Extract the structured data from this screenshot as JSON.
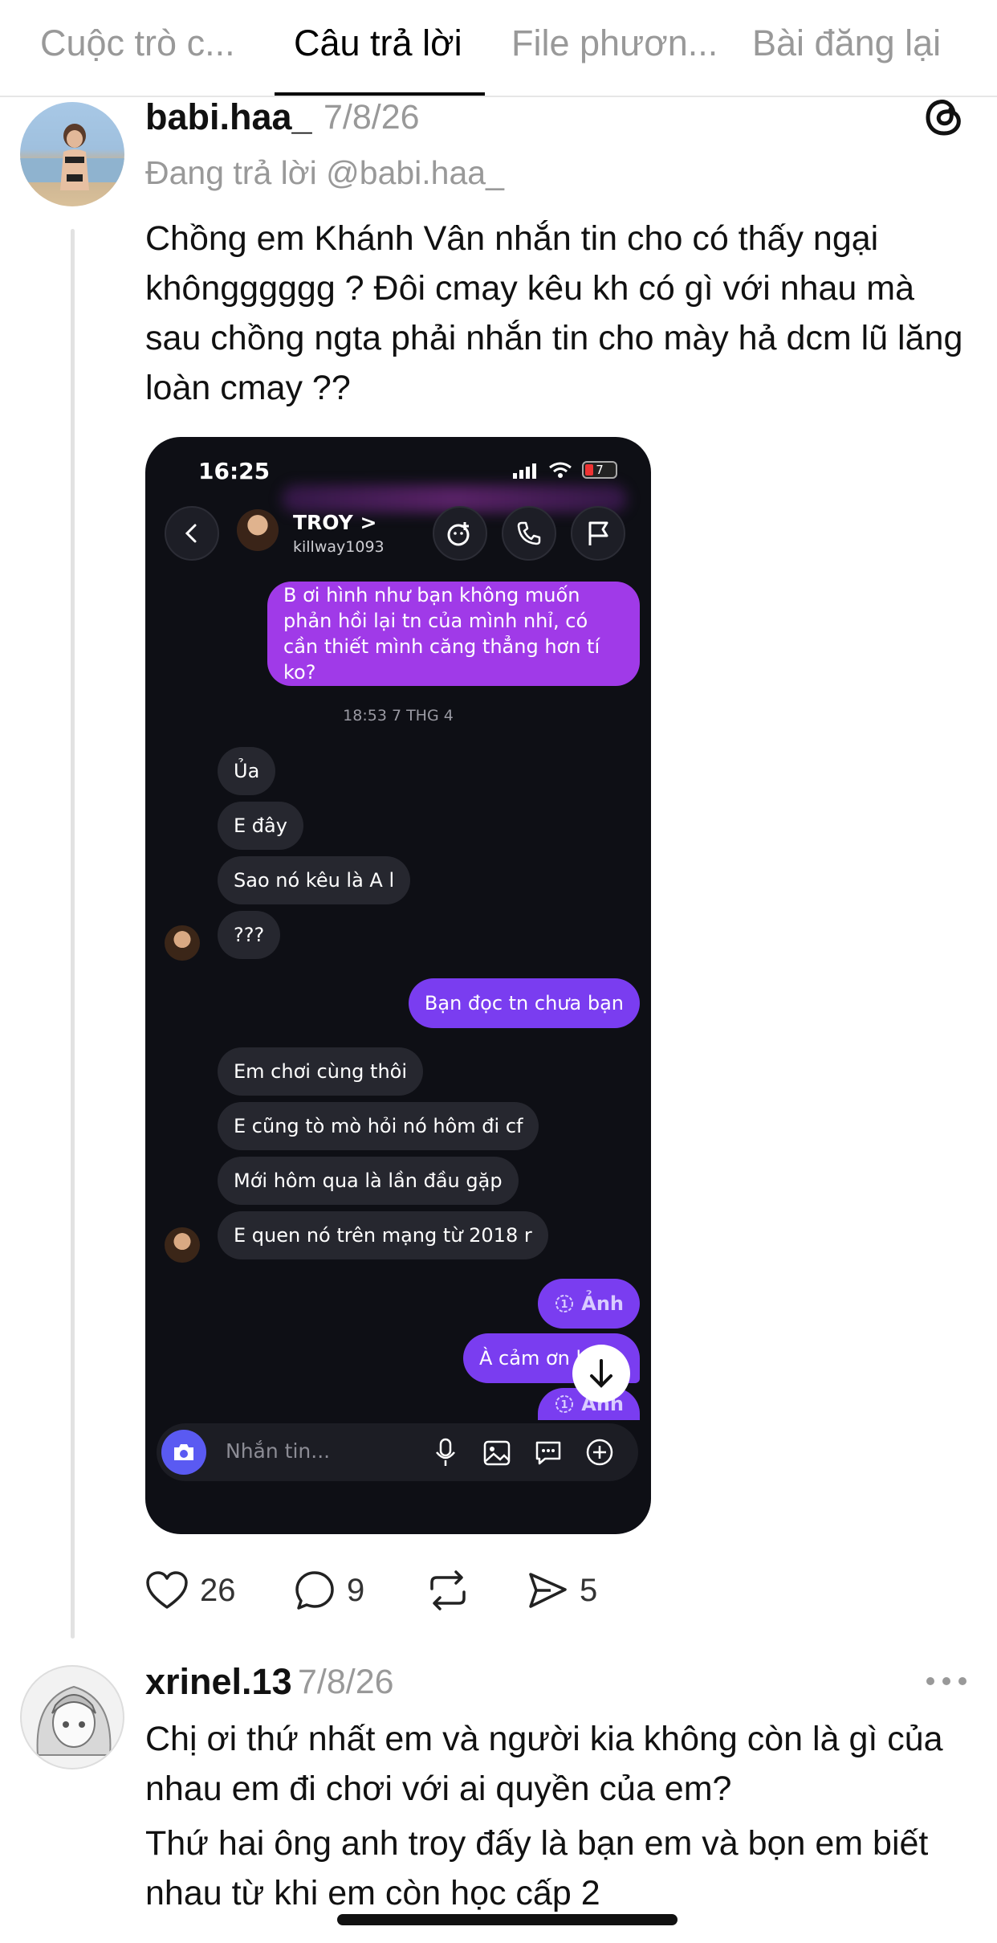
{
  "tabs": [
    {
      "label": "Cuộc trò c..."
    },
    {
      "label": "Câu trả lời"
    },
    {
      "label": "File phươn..."
    },
    {
      "label": "Bài đăng lại"
    }
  ],
  "post": {
    "username": "babi.haa_",
    "date": "7/8/26",
    "replying_to": "Đang trả lời @babi.haa_",
    "text": "Chồng em Khánh Vân nhắn tin cho có thấy ngại khôngggggg ? Đôi cmay kêu kh có gì với nhau mà sau chồng ngta phải nhắn tin cho mày hả dcm lũ lăng loàn cmay ??",
    "actions": {
      "likes": "26",
      "comments": "9",
      "shares": "5"
    }
  },
  "screenshot": {
    "time": "16:25",
    "battery": "7",
    "contact_name": "TROY >",
    "contact_handle": "killway1093",
    "messages": {
      "m1": "B ơi hình như bạn không muốn phản hồi lại tn của mình nhỉ, có cần thiết mình căng thẳng hơn tí ko?",
      "stamp": "18:53 7 THG 4",
      "m2": "Ủa",
      "m3": "E đây",
      "m4": "Sao nó kêu là A l",
      "m5": "???",
      "m6": "Bạn đọc tn chưa bạn",
      "m7": "Em chơi cùng thôi",
      "m8": "E cũng tò mò hỏi nó hôm đi cf",
      "m9": "Mới hôm qua là lần đầu gặp",
      "m10": "E quen nó trên mạng từ 2018 r",
      "m11": "Ảnh",
      "m12": "À cảm ơn b",
      "m13": "Ảnh"
    },
    "input_placeholder": "Nhắn tin..."
  },
  "reply": {
    "username": "xrinel.13",
    "date": "7/8/26",
    "text1": "Chị ơi thứ nhất em và người kia không còn là gì của nhau em đi chơi với ai quyền của em?",
    "text2": "Thứ hai ông anh troy đấy là bạn em và bọn em biết nhau từ khi em còn học cấp 2"
  }
}
